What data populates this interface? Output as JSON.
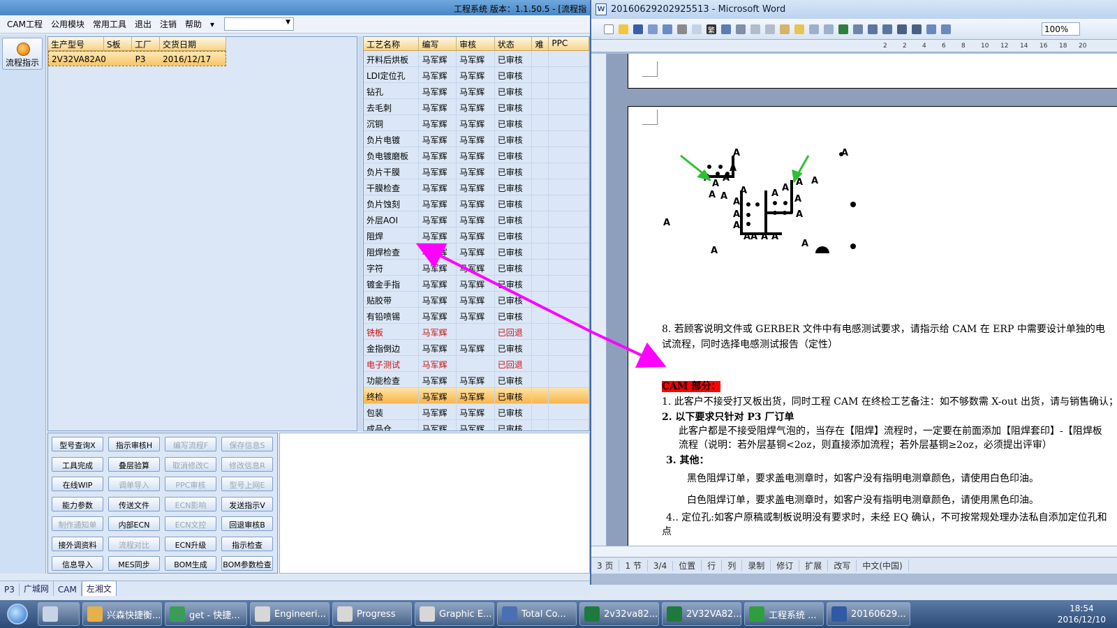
{
  "app": {
    "title": "工程系统   版本：1.1.50.5 - [流程指",
    "menu": [
      "CAM工程",
      "公用模块",
      "常用工具",
      "退出",
      "注销",
      "帮助"
    ],
    "flow_button_label": "流程指示"
  },
  "product_grid": {
    "headers": [
      "生产型号",
      "S板",
      "工厂",
      "交货日期"
    ],
    "rows": [
      [
        "2V32VA82A0",
        "",
        "P3",
        "2016/12/17"
      ]
    ]
  },
  "process_grid": {
    "headers": [
      "工艺名称",
      "编写",
      "审核",
      "状态",
      "难",
      "PPC"
    ],
    "rows": [
      [
        "开料后烘板",
        "马军辉",
        "马军辉",
        "已审核"
      ],
      [
        "LDI定位孔",
        "马军辉",
        "马军辉",
        "已审核"
      ],
      [
        "钻孔",
        "马军辉",
        "马军辉",
        "已审核"
      ],
      [
        "去毛刺",
        "马军辉",
        "马军辉",
        "已审核"
      ],
      [
        "沉铜",
        "马军辉",
        "马军辉",
        "已审核"
      ],
      [
        "负片电镀",
        "马军辉",
        "马军辉",
        "已审核"
      ],
      [
        "负电镀磨板",
        "马军辉",
        "马军辉",
        "已审核"
      ],
      [
        "负片干膜",
        "马军辉",
        "马军辉",
        "已审核"
      ],
      [
        "干膜检查",
        "马军辉",
        "马军辉",
        "已审核"
      ],
      [
        "负片蚀刻",
        "马军辉",
        "马军辉",
        "已审核"
      ],
      [
        "外层AOI",
        "马军辉",
        "马军辉",
        "已审核"
      ],
      [
        "阻焊",
        "马军辉",
        "马军辉",
        "已审核"
      ],
      [
        "阻焊检查",
        "马军辉",
        "马军辉",
        "已审核"
      ],
      [
        "字符",
        "马军辉",
        "马军辉",
        "已审核"
      ],
      [
        "镀金手指",
        "马军辉",
        "马军辉",
        "已审核"
      ],
      [
        "贴胶带",
        "马军辉",
        "马军辉",
        "已审核"
      ],
      [
        "有铅喷锡",
        "马军辉",
        "马军辉",
        "已审核"
      ],
      [
        "铣板",
        "马军辉",
        "",
        "已回退"
      ],
      [
        "金指倒边",
        "马军辉",
        "马军辉",
        "已审核"
      ],
      [
        "电子测试",
        "马军辉",
        "",
        "已回退"
      ],
      [
        "功能检查",
        "马军辉",
        "马军辉",
        "已审核"
      ],
      [
        "终检",
        "马军辉",
        "马军辉",
        "已审核"
      ],
      [
        "包装",
        "马军辉",
        "马军辉",
        "已审核"
      ],
      [
        "成品仓",
        "马军辉",
        "马军辉",
        "已审核"
      ]
    ]
  },
  "buttons": [
    [
      "型号查询X",
      "指示审核H",
      "编写流程F",
      "保存信息S"
    ],
    [
      "工具完成",
      "叠层验算",
      "取消修改C",
      "修改信息R"
    ],
    [
      "在线WIP",
      "调单导入",
      "PPC审核",
      "型号上网E"
    ],
    [
      "能力参数",
      "传送文件",
      "ECN影响",
      "发送指示V"
    ],
    [
      "制作通知单",
      "内部ECN",
      "ECN文控",
      "回退审核B"
    ],
    [
      "接外调资料",
      "流程对比",
      "ECN升级",
      "指示检查"
    ],
    [
      "信息导入",
      "MES同步",
      "BOM生成",
      "BOM参数检查"
    ]
  ],
  "bottom_tabs": [
    "P3",
    "广城网",
    "CAM",
    "左湘文"
  ],
  "word": {
    "title": "20160629202925513 - Microsoft Word",
    "zoom": "100%",
    "ruler_ticks": [
      "2",
      "2",
      "4",
      "6",
      "8",
      "10",
      "12",
      "14",
      "16",
      "18",
      "20"
    ],
    "para8_line1": "8. 若顾客说明文件或 GERBER 文件中有电感测试要求，请指示给 CAM 在 ERP 中需要设计单独的电",
    "para8_line2": "试流程，同时选择电感测试报告（定性）",
    "cam_heading": "CAM 部分：",
    "item1": "1.   此客户不接受打叉板出货，同时工程 CAM 在终检工艺备注：如不够数需 X-out 出货，请与销售确认；",
    "item2": "2.   以下要求只针对 P3 厂订单",
    "item2_line1": "此客户都是不接受阻焊气泡的，当存在【阻焊】流程时，一定要在前面添加【阻焊套印】-【阻焊板",
    "item2_line2": "流程（说明：若外层基铜<2oz，则直接添加流程；若外层基铜≥2oz，必须提出评审）",
    "item3": "3.   其他：",
    "item3_line1": "黑色阻焊订单，要求盖电测章时，如客户没有指明电测章颜色，请使用白色印油。",
    "item3_line2": "白色阻焊订单，要求盖电测章时，如客户没有指明电测章颜色，请使用黑色印油。",
    "item4": "4.. 定位孔:如客户原稿或制板说明没有要求时，未经 EQ 确认，不可按常规处理办法私自添加定位孔和",
    "item4_line2": "点",
    "status": [
      "3 页",
      "1 节",
      "3/4",
      "位置",
      "行",
      "列",
      "录制",
      "修订",
      "扩展",
      "改写",
      "中文(中国)"
    ]
  },
  "taskbar": {
    "items": [
      "兴森快捷衡...",
      "get - 快捷...",
      "Engineeri...",
      "Progress",
      "Graphic E...",
      "Total Co...",
      "2v32va82...",
      "2V32VA82...",
      "工程系统 ...",
      "20160629..."
    ],
    "time": "18:54",
    "date": "2016/12/10"
  },
  "colors": {
    "selected_row": "#f7b64b",
    "rejected": "#d01010",
    "arrow": "#ff00ff",
    "cam_label_bg": "#ff0000"
  }
}
